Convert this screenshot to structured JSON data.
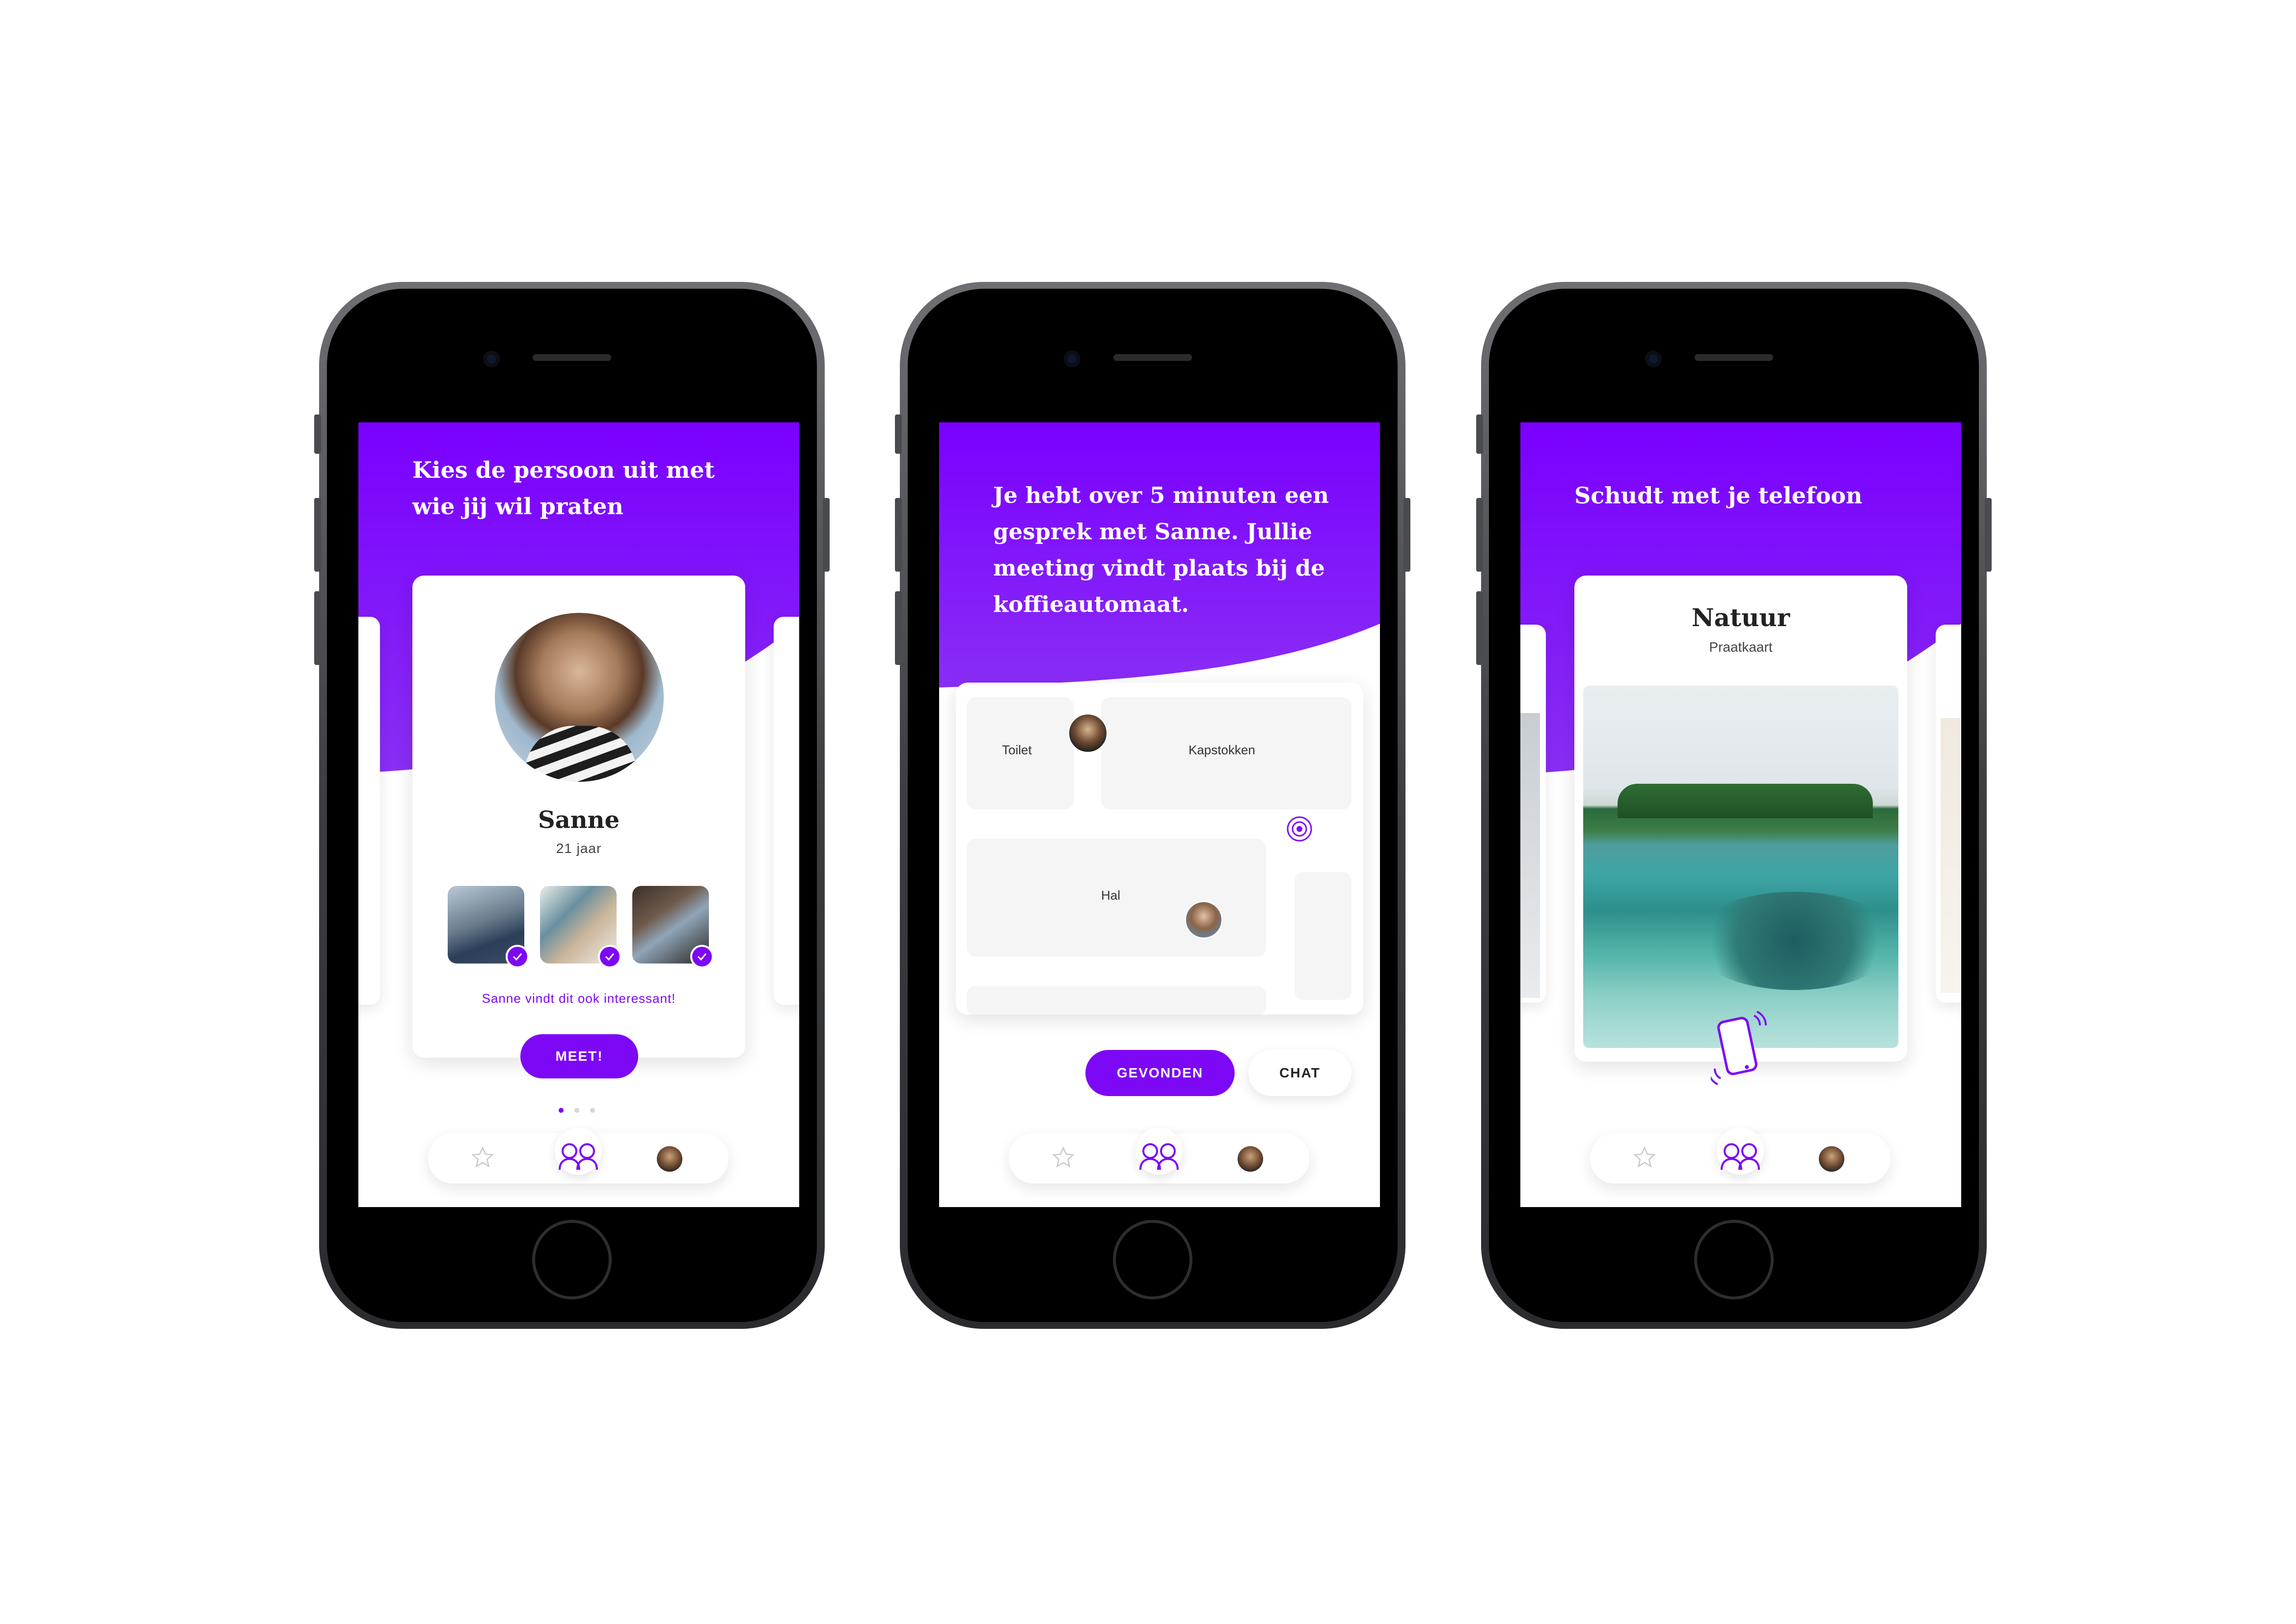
{
  "colors": {
    "accent": "#7d08f5",
    "hero_top": "#7a00ff",
    "hero_bottom": "#8a2ff5"
  },
  "screen1": {
    "title_line1": "Kies de persoon uit met",
    "title_line2": "wie jij wil praten",
    "profile_name": "Sanne",
    "profile_age": "21 jaar",
    "interest_note": "Sanne vindt dit ook interessant!",
    "meet_button": "MEET!",
    "pagination": {
      "active": 1,
      "total": 3
    }
  },
  "screen2": {
    "title_line1": "Je hebt over 5 minuten een",
    "title_line2": "gesprek met Sanne. Jullie",
    "title_line3": "meeting vindt plaats bij de",
    "title_line4": "koffieautomaat.",
    "map_labels": {
      "toilet": "Toilet",
      "coat_rack": "Kapstokken",
      "hall": "Hal"
    },
    "found_button": "GEVONDEN",
    "chat_button": "CHAT"
  },
  "screen3": {
    "title": "Schudt met je telefoon",
    "card_title": "Natuur",
    "card_subtitle": "Praatkaart"
  },
  "nav": {
    "items": [
      "star-icon",
      "people-icon",
      "profile-avatar"
    ],
    "active": "people-icon"
  }
}
